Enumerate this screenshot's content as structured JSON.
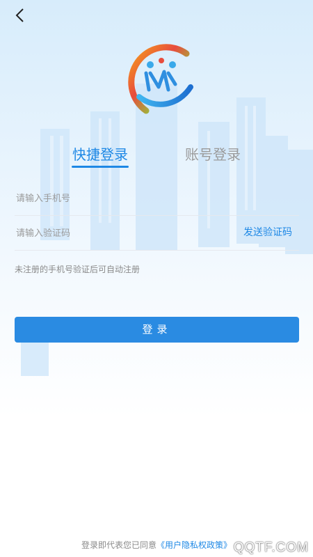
{
  "header": {
    "back_icon": "chevron-left-icon"
  },
  "logo": {
    "icon": "family-hand-logo"
  },
  "tabs": [
    {
      "label": "快捷登录",
      "active": true
    },
    {
      "label": "账号登录",
      "active": false
    }
  ],
  "form": {
    "phone_placeholder": "请输入手机号",
    "code_placeholder": "请输入验证码",
    "send_code_label": "发送验证码",
    "hint": "未注册的手机号验证后可自动注册",
    "login_label": "登录"
  },
  "footer": {
    "agreement_prefix": "登录即代表您已同意",
    "policy_link": "《用户隐私权政策》"
  },
  "watermark": "QQTF.COM",
  "colors": {
    "accent": "#1e88e5",
    "button": "#2a8be2",
    "inactive_tab": "#9a9a9a"
  }
}
